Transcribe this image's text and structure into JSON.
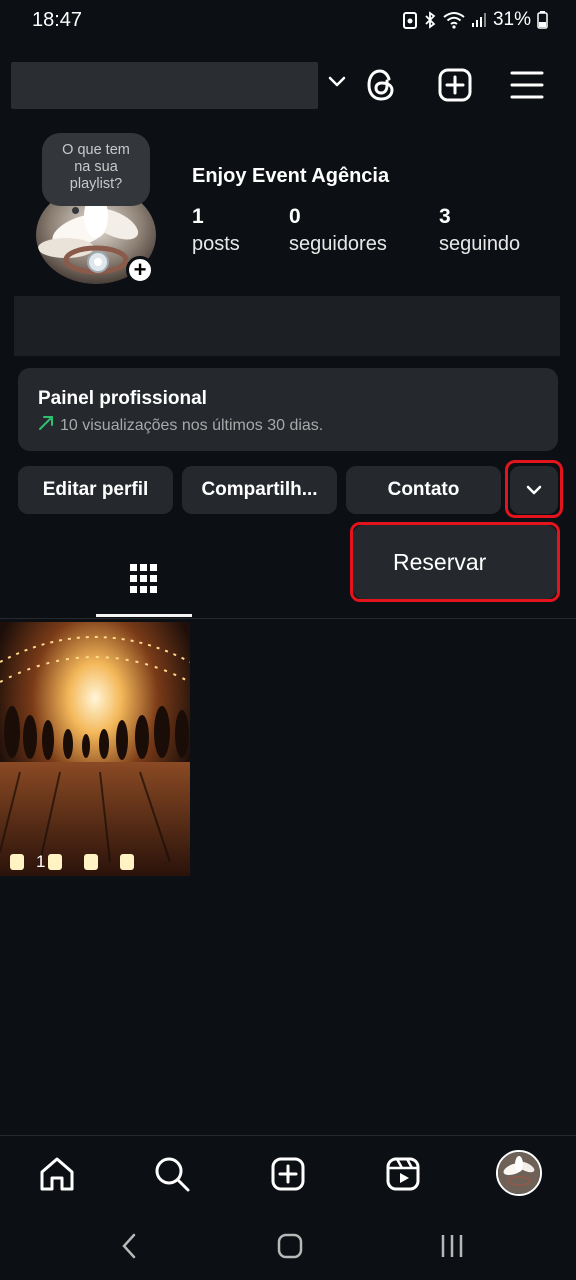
{
  "status_bar": {
    "time": "18:47",
    "battery": "31%"
  },
  "profile": {
    "name": "Enjoy Event Agência",
    "note_lines": [
      "O que tem",
      "na sua",
      "playlist?"
    ],
    "stats": [
      {
        "number": "1",
        "label": "posts"
      },
      {
        "number": "0",
        "label": "seguidores"
      },
      {
        "number": "3",
        "label": "seguindo"
      }
    ]
  },
  "panel": {
    "title": "Painel profissional",
    "subtitle": "10 visualizações nos últimos 30 dias."
  },
  "buttons": {
    "edit": "Editar perfil",
    "share": "Compartilh...",
    "contact": "Contato"
  },
  "dropdown_menu": {
    "item": "Reservar"
  },
  "posts": [
    {
      "carousel_count": "1"
    }
  ],
  "colors": {
    "background": "#0c1014",
    "surface": "#25292e",
    "highlight": "#e3141b",
    "trend": "#2fbf71"
  }
}
